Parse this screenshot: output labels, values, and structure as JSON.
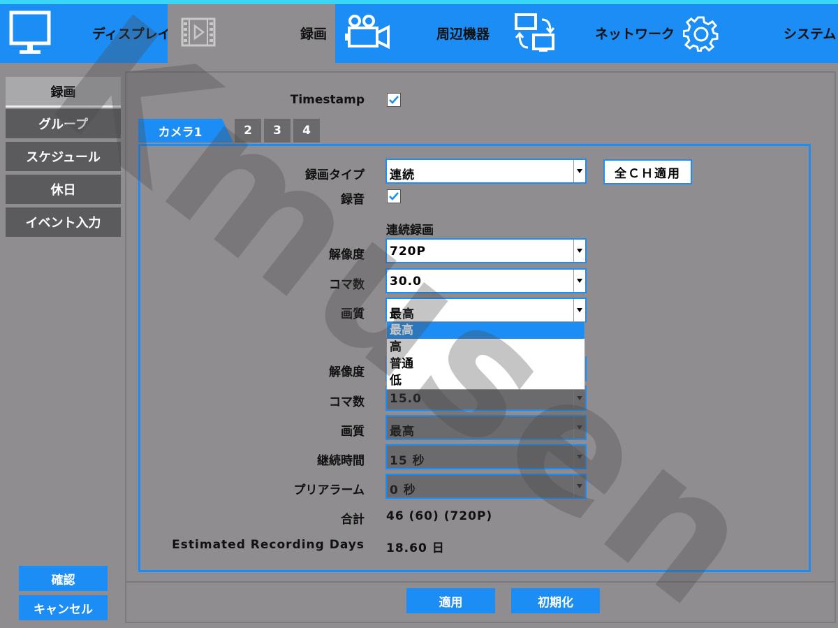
{
  "nav": {
    "display": {
      "label": "ディスプレイ",
      "icon": "monitor-icon"
    },
    "record": {
      "label": "録画",
      "icon": "film-icon"
    },
    "device": {
      "label": "周辺機器",
      "icon": "video-camera-icon"
    },
    "network": {
      "label": "ネットワーク",
      "icon": "network-icon"
    },
    "system": {
      "label": "システム",
      "icon": "gear-icon"
    }
  },
  "sidebar": {
    "items": [
      {
        "label": "録画",
        "active": true
      },
      {
        "label": "グループ"
      },
      {
        "label": "スケジュール"
      },
      {
        "label": "休日"
      },
      {
        "label": "イベント入力"
      }
    ],
    "confirm_label": "確認",
    "cancel_label": "キャンセル"
  },
  "timestamp": {
    "label": "Timestamp",
    "checked": true
  },
  "tabs": [
    "カメラ1",
    "2",
    "3",
    "4"
  ],
  "camera": {
    "record_type": {
      "label": "録画タイプ",
      "value": "連続"
    },
    "apply_all_label": "全ＣＨ適用",
    "audio": {
      "label": "録音",
      "checked": true
    },
    "continuous_heading": "連続録画",
    "continuous": {
      "resolution": {
        "label": "解像度",
        "value": "720P"
      },
      "fps": {
        "label": "コマ数",
        "value": "30.0"
      },
      "quality": {
        "label": "画質",
        "value": "最高",
        "options": [
          "最高",
          "高",
          "普通",
          "低"
        ]
      }
    },
    "event": {
      "resolution": {
        "label": "解像度"
      },
      "fps": {
        "label": "コマ数",
        "value": "15.0"
      },
      "quality": {
        "label": "画質",
        "value": "最高"
      },
      "duration": {
        "label": "継続時間",
        "value": "15 秒"
      },
      "prealarm": {
        "label": "プリアラーム",
        "value": "0 秒"
      }
    },
    "total": {
      "label": "合計",
      "value": "46 (60) (720P)"
    },
    "days": {
      "label": "Estimated Recording Days",
      "value": "18.60 日"
    }
  },
  "actions": {
    "apply_label": "適用",
    "reset_label": "初期化"
  },
  "watermark": "Kmusen",
  "colors": {
    "accent": "#1c8df5",
    "top_border": "#39d7f5",
    "background": "#8f8d90",
    "sidebar": "#5b5a5d"
  }
}
